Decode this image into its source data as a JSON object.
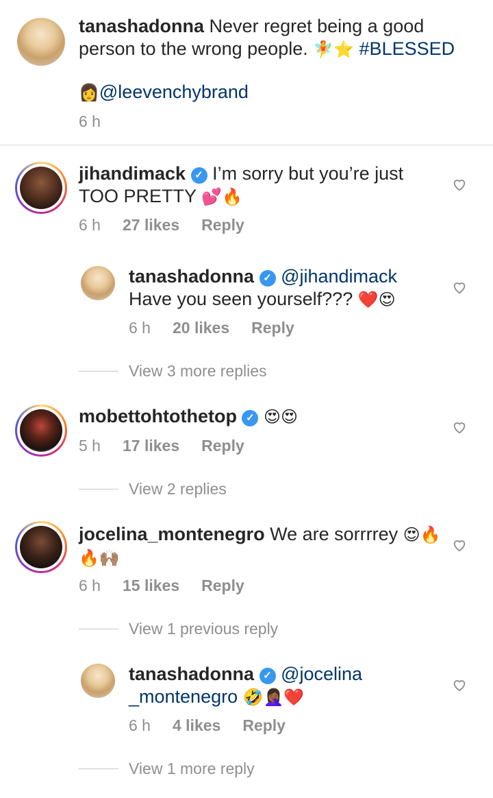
{
  "caption": {
    "username": "tanashadonna",
    "text_line1": "Never regret being a good",
    "text_line2": "person to the wrong people.",
    "emojis1": "🧚⭐",
    "hashtag": "#BLESSED",
    "emoji_mention_prefix": "👩",
    "mention": "@leevenchybrand",
    "time": "6 h"
  },
  "comments": [
    {
      "username": "jihandimack",
      "text_line1": "I’m sorry but you’re just",
      "text_line2": "TOO PRETTY",
      "emojis": "💕🔥",
      "time": "6 h",
      "likes": "27 likes",
      "reply_label": "Reply",
      "replies": [
        {
          "username": "tanashadonna",
          "mention": "@jihandimack",
          "text": "Have you seen yourself???",
          "emojis": "❤️😍",
          "time": "6 h",
          "likes": "20 likes",
          "reply_label": "Reply"
        }
      ],
      "view_more": "View 3 more replies"
    },
    {
      "username": "mobettohtothetop",
      "emojis": "😍😍",
      "time": "5 h",
      "likes": "17 likes",
      "reply_label": "Reply",
      "view_more": "View 2 replies"
    },
    {
      "username": "jocelina_montenegro",
      "text_line1": "We are sorrrrey",
      "emojis1": "😍🔥",
      "emojis2": "🔥🙌🏽",
      "time": "6 h",
      "likes": "15 likes",
      "reply_label": "Reply",
      "view_previous": "View 1 previous reply",
      "replies": [
        {
          "username": "tanashadonna",
          "mention_line1": "@jocelina",
          "mention_line2": "_montenegro",
          "emojis": "🤣🤦🏾‍♀️❤️",
          "time": "6 h",
          "likes": "4 likes",
          "reply_label": "Reply"
        }
      ],
      "view_more": "View 1 more reply"
    }
  ],
  "icons": {
    "heart": "heart-outline-icon",
    "verified": "verified-badge-icon"
  },
  "colors": {
    "link": "#003569",
    "verified": "#3897f0",
    "secondary_text": "#8e8e8e"
  }
}
